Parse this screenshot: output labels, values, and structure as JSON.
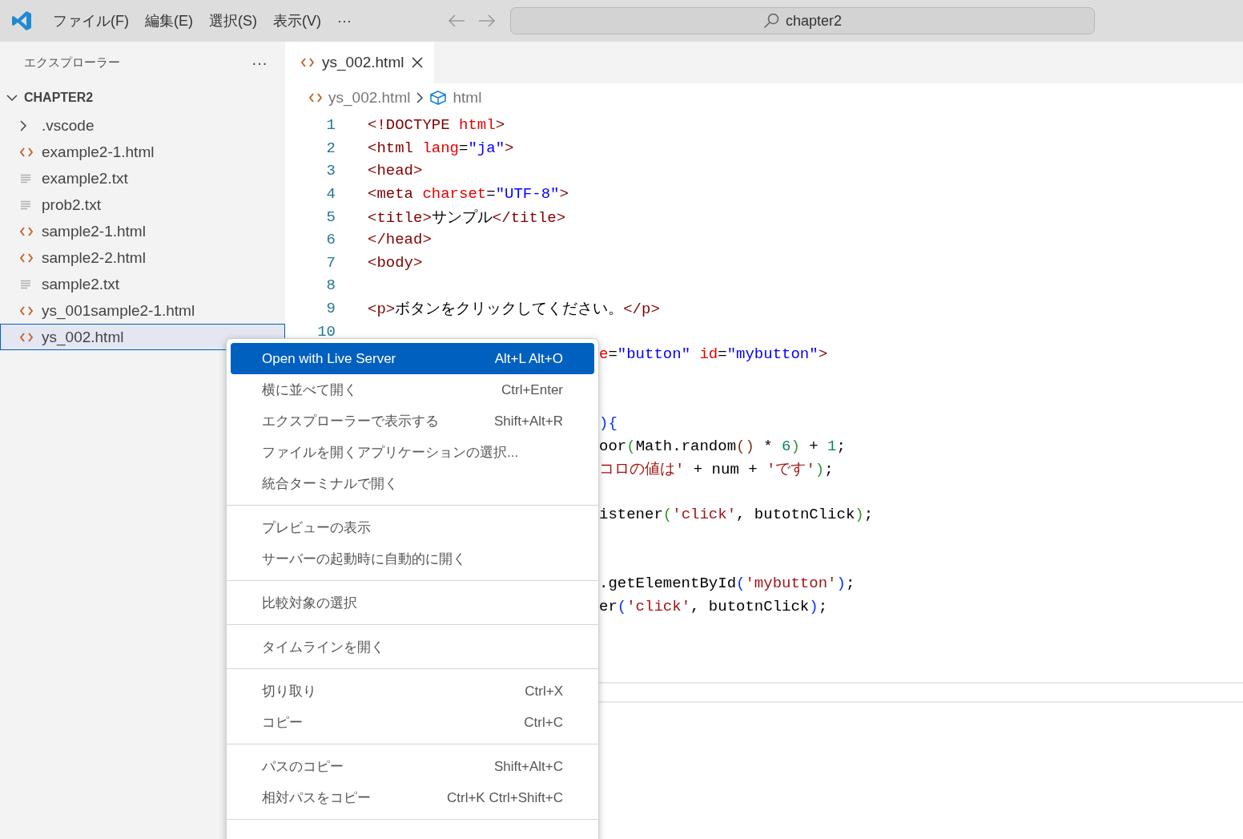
{
  "title_bar": {
    "menus": [
      "ファイル(F)",
      "編集(E)",
      "選択(S)",
      "表示(V)",
      "···"
    ],
    "search": {
      "value": "chapter2"
    }
  },
  "sidebar": {
    "title": "エクスプローラー",
    "more": "···",
    "root": {
      "label": "CHAPTER2",
      "expanded": true,
      "children": [
        {
          "label": ".vscode",
          "kind": "folder",
          "expanded": false,
          "selected": false
        },
        {
          "label": "example2-1.html",
          "kind": "html",
          "selected": false
        },
        {
          "label": "example2.txt",
          "kind": "txt",
          "selected": false
        },
        {
          "label": "prob2.txt",
          "kind": "txt",
          "selected": false
        },
        {
          "label": "sample2-1.html",
          "kind": "html",
          "selected": false
        },
        {
          "label": "sample2-2.html",
          "kind": "html",
          "selected": false
        },
        {
          "label": "sample2.txt",
          "kind": "txt",
          "selected": false
        },
        {
          "label": "ys_001sample2-1.html",
          "kind": "html",
          "selected": false
        },
        {
          "label": "ys_002.html",
          "kind": "html",
          "selected": true
        }
      ]
    }
  },
  "editor": {
    "tabs": [
      {
        "label": "ys_002.html",
        "selected": true
      }
    ],
    "breadcrumb": [
      "ys_002.html",
      "html"
    ],
    "lines": [
      {
        "number": "1",
        "tokens": [
          {
            "text": "<!DOCTYPE",
            "kind": "tag"
          },
          {
            "text": " html",
            "kind": "attr"
          },
          {
            "text": ">",
            "kind": "tag"
          }
        ]
      },
      {
        "number": "2",
        "tokens": [
          {
            "text": "<html",
            "kind": "tag"
          },
          {
            "text": " lang",
            "kind": "attr"
          },
          {
            "text": "=",
            "kind": "plain"
          },
          {
            "text": "\"ja\"",
            "kind": "value"
          },
          {
            "text": ">",
            "kind": "tag"
          }
        ]
      },
      {
        "number": "3",
        "tokens": [
          {
            "text": "<head>",
            "kind": "tag"
          }
        ]
      },
      {
        "number": "4",
        "tokens": [
          {
            "text": "<meta",
            "kind": "tag"
          },
          {
            "text": " charset",
            "kind": "attr"
          },
          {
            "text": "=",
            "kind": "plain"
          },
          {
            "text": "\"UTF-8\"",
            "kind": "value"
          },
          {
            "text": ">",
            "kind": "tag"
          }
        ]
      },
      {
        "number": "5",
        "tokens": [
          {
            "text": "<title>",
            "kind": "tag"
          },
          {
            "text": "サンプル",
            "kind": "plain"
          },
          {
            "text": "</title>",
            "kind": "tag"
          }
        ]
      },
      {
        "number": "6",
        "tokens": [
          {
            "text": "</head>",
            "kind": "tag"
          }
        ]
      },
      {
        "number": "7",
        "tokens": [
          {
            "text": "<body>",
            "kind": "tag"
          }
        ]
      },
      {
        "number": "8"
      },
      {
        "number": "9",
        "tokens": [
          {
            "text": "<p>",
            "kind": "tag"
          },
          {
            "text": "ボタンをクリックしてください。",
            "kind": "plain"
          },
          {
            "text": "</p>",
            "kind": "tag"
          }
        ]
      },
      {
        "number": "10"
      },
      {
        "kind": "partial",
        "tokens": [
          {
            "text": "e",
            "kind": "attr"
          },
          {
            "text": "=",
            "kind": "plain"
          },
          {
            "text": "\"button\"",
            "kind": "value"
          },
          {
            "text": " id",
            "kind": "attr"
          },
          {
            "text": "=",
            "kind": "plain"
          },
          {
            "text": "\"mybutton\"",
            "kind": "value"
          },
          {
            "text": ">",
            "kind": "tag"
          }
        ]
      },
      {
        "kind": "blank"
      },
      {
        "kind": "blank"
      },
      {
        "kind": "partial",
        "tokens": [
          {
            "text": "){",
            "kind": "bracket2"
          }
        ]
      },
      {
        "kind": "partial",
        "tokens": [
          {
            "text": "oor",
            "kind": "plain"
          },
          {
            "text": "(",
            "kind": "bracket1"
          },
          {
            "text": "Math.random",
            "kind": "plain"
          },
          {
            "text": "()",
            "kind": "bracket3"
          },
          {
            "text": " * ",
            "kind": "plain"
          },
          {
            "text": "6",
            "kind": "num"
          },
          {
            "text": ")",
            "kind": "bracket1"
          },
          {
            "text": " + ",
            "kind": "plain"
          },
          {
            "text": "1",
            "kind": "num"
          },
          {
            "text": ";",
            "kind": "plain"
          }
        ]
      },
      {
        "kind": "partial",
        "tokens": [
          {
            "text": "コロの値は'",
            "kind": "string"
          },
          {
            "text": " + num + ",
            "kind": "plain"
          },
          {
            "text": "'です'",
            "kind": "string"
          },
          {
            "text": ")",
            "kind": "bracket1"
          },
          {
            "text": ";",
            "kind": "plain"
          }
        ]
      },
      {
        "kind": "blank"
      },
      {
        "kind": "partial",
        "tokens": [
          {
            "text": "istener",
            "kind": "plain"
          },
          {
            "text": "(",
            "kind": "bracket1"
          },
          {
            "text": "'click'",
            "kind": "string"
          },
          {
            "text": ", butotnClick",
            "kind": "plain"
          },
          {
            "text": ")",
            "kind": "bracket1"
          },
          {
            "text": ";",
            "kind": "plain"
          }
        ]
      },
      {
        "kind": "blank"
      },
      {
        "kind": "blank"
      },
      {
        "kind": "partial",
        "tokens": [
          {
            "text": ".getElementById",
            "kind": "plain"
          },
          {
            "text": "(",
            "kind": "bracket2"
          },
          {
            "text": "'mybutton'",
            "kind": "string"
          },
          {
            "text": ")",
            "kind": "bracket2"
          },
          {
            "text": ";",
            "kind": "plain"
          }
        ]
      },
      {
        "kind": "partial",
        "tokens": [
          {
            "text": "er",
            "kind": "plain"
          },
          {
            "text": "(",
            "kind": "bracket2"
          },
          {
            "text": "'click'",
            "kind": "string"
          },
          {
            "text": ", butotnClick",
            "kind": "plain"
          },
          {
            "text": ")",
            "kind": "bracket2"
          },
          {
            "text": ";",
            "kind": "plain"
          }
        ]
      }
    ]
  },
  "context_menu": {
    "groups": [
      [
        {
          "label": "Open with Live Server",
          "shortcut": "Alt+L Alt+O",
          "selected": true
        },
        {
          "label": "横に並べて開く",
          "shortcut": "Ctrl+Enter",
          "selected": false
        },
        {
          "label": "エクスプローラーで表示する",
          "shortcut": "Shift+Alt+R",
          "selected": false
        },
        {
          "label": "ファイルを開くアプリケーションの選択...",
          "selected": false
        },
        {
          "label": "統合ターミナルで開く",
          "selected": false
        }
      ],
      [
        {
          "label": "プレビューの表示",
          "selected": false
        },
        {
          "label": "サーバーの起動時に自動的に開く",
          "selected": false
        }
      ],
      [
        {
          "label": "比較対象の選択",
          "selected": false
        }
      ],
      [
        {
          "label": "タイムラインを開く",
          "selected": false
        }
      ],
      [
        {
          "label": "切り取り",
          "shortcut": "Ctrl+X",
          "selected": false
        },
        {
          "label": "コピー",
          "shortcut": "Ctrl+C",
          "selected": false
        }
      ],
      [
        {
          "label": "パスのコピー",
          "shortcut": "Shift+Alt+C",
          "selected": false
        },
        {
          "label": "相対パスをコピー",
          "shortcut": "Ctrl+K Ctrl+Shift+C",
          "selected": false
        }
      ]
    ]
  }
}
